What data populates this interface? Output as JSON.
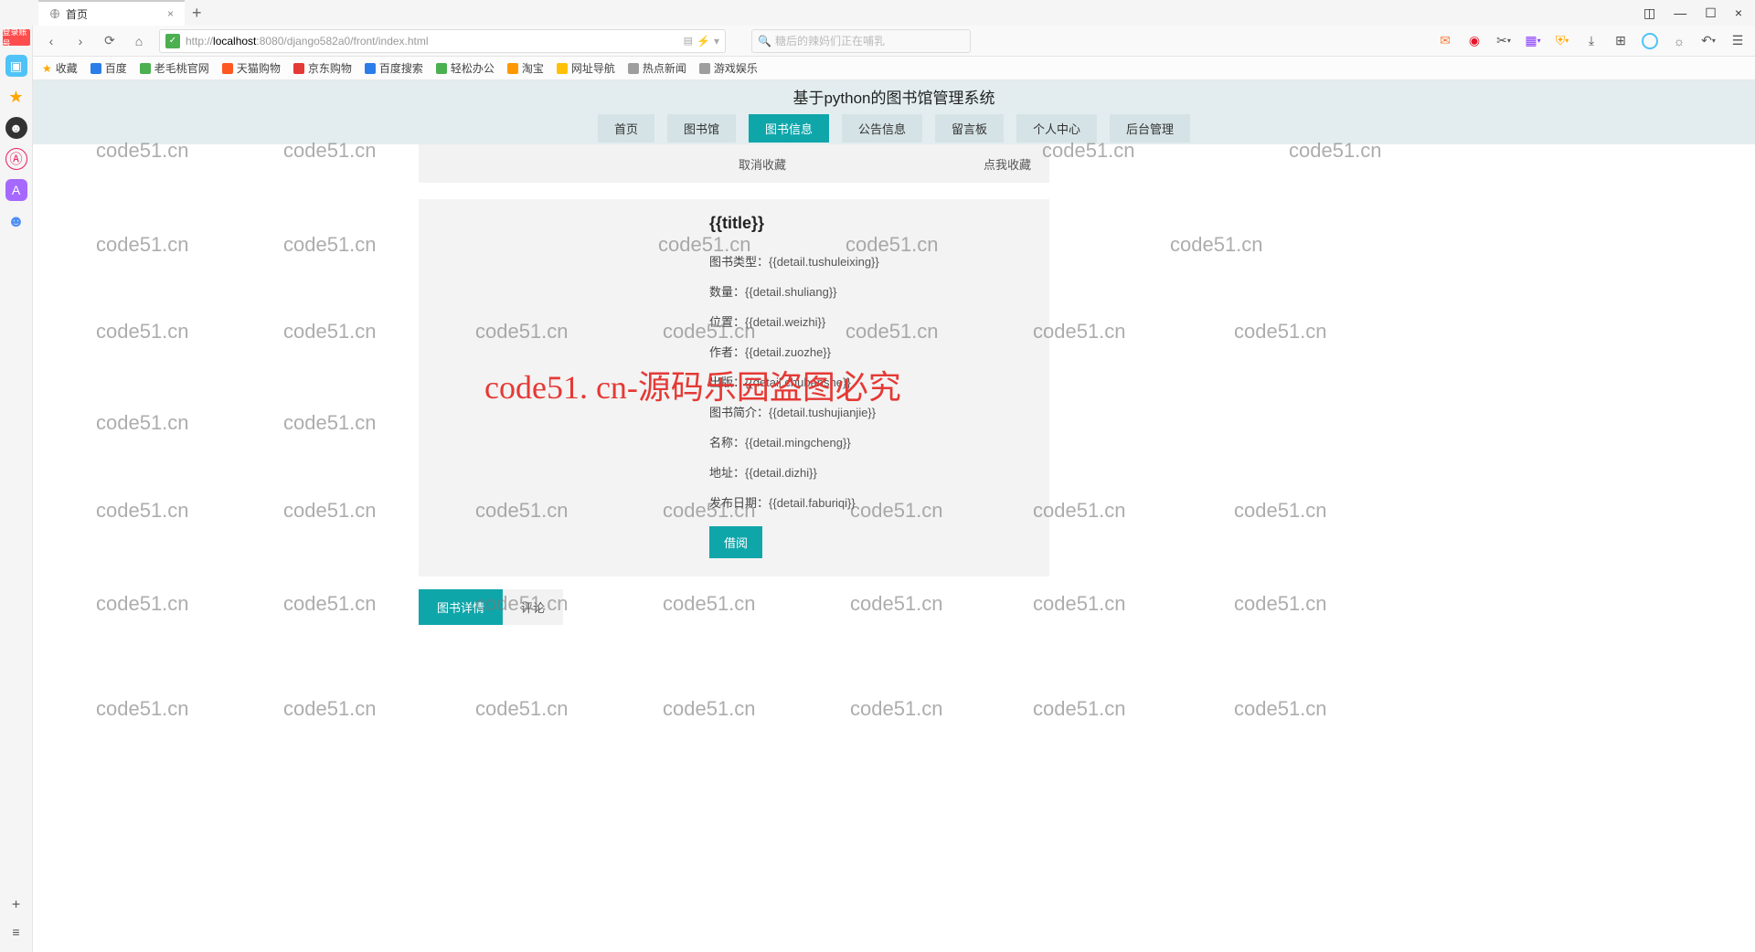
{
  "browser": {
    "tab_title": "首页",
    "url_host": "localhost",
    "url_prefix": "http://",
    "url_port_path": ":8080/django582a0/front/index.html",
    "search_placeholder": "糖后的辣妈们正在哺乳",
    "login_badge": "登录账号"
  },
  "bookmarks": [
    {
      "label": "收藏",
      "star": true
    },
    {
      "label": "百度"
    },
    {
      "label": "老毛桃官网"
    },
    {
      "label": "天猫购物"
    },
    {
      "label": "京东购物"
    },
    {
      "label": "百度搜索"
    },
    {
      "label": "轻松办公"
    },
    {
      "label": "淘宝"
    },
    {
      "label": "网址导航"
    },
    {
      "label": "热点新闻"
    },
    {
      "label": "游戏娱乐"
    }
  ],
  "site": {
    "title": "基于python的图书馆管理系统",
    "nav": [
      {
        "label": "首页",
        "active": false
      },
      {
        "label": "图书馆",
        "active": false
      },
      {
        "label": "图书信息",
        "active": true
      },
      {
        "label": "公告信息",
        "active": false
      },
      {
        "label": "留言板",
        "active": false
      },
      {
        "label": "个人中心",
        "active": false
      },
      {
        "label": "后台管理",
        "active": false
      }
    ]
  },
  "actions": {
    "cancel_fav": "取消收藏",
    "add_fav": "点我收藏"
  },
  "detail": {
    "title": "{{title}}",
    "fields": [
      {
        "label": "图书类型：",
        "value": "{{detail.tushuleixing}}"
      },
      {
        "label": "数量：",
        "value": "{{detail.shuliang}}"
      },
      {
        "label": "位置：",
        "value": "{{detail.weizhi}}"
      },
      {
        "label": "作者：",
        "value": "{{detail.zuozhe}}"
      },
      {
        "label": "出版：",
        "value": "{{detail.chubanshe}}"
      },
      {
        "label": "图书简介：",
        "value": "{{detail.tushujianjie}}"
      },
      {
        "label": "名称：",
        "value": "{{detail.mingcheng}}"
      },
      {
        "label": "地址：",
        "value": "{{detail.dizhi}}"
      },
      {
        "label": "发布日期：",
        "value": "{{detail.faburiqi}}"
      }
    ],
    "borrow_btn": "借阅"
  },
  "tabs": [
    {
      "label": "图书详情",
      "active": true
    },
    {
      "label": "评论",
      "active": false
    }
  ],
  "watermark": {
    "small": "code51.cn",
    "big": "code51. cn-源码乐园盗图必究"
  }
}
